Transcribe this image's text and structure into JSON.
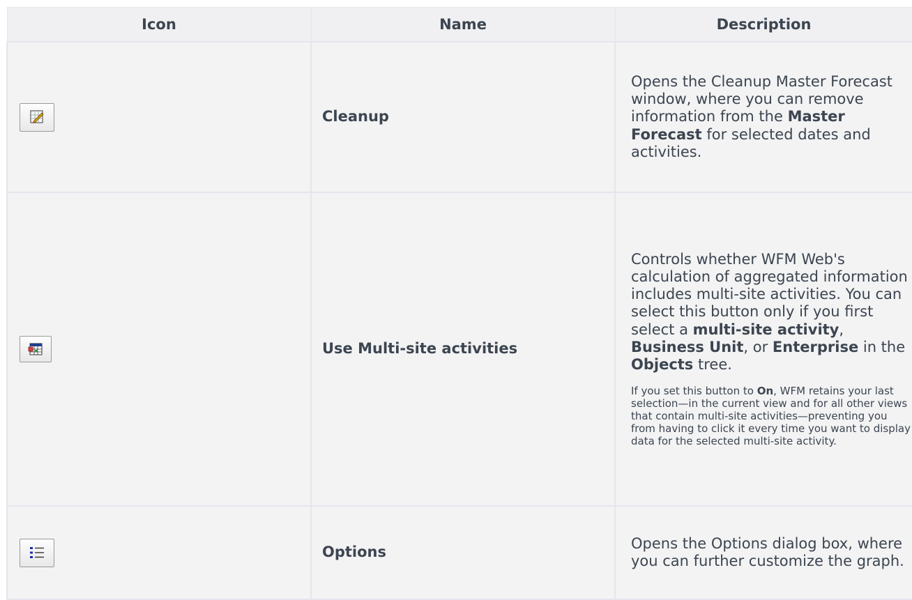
{
  "table": {
    "headers": {
      "icon": "Icon",
      "name": "Name",
      "description": "Description"
    },
    "rows": [
      {
        "icon": "cleanup-icon",
        "name": "Cleanup",
        "desc": {
          "t1": "Opens the Cleanup Master Forecast window, where you can remove information from the ",
          "b1": "Master Forecast",
          "t2": " for selected dates and activities."
        }
      },
      {
        "icon": "multi-site-activities-icon",
        "name": "Use Multi-site activities",
        "desc": {
          "t1": "Controls whether WFM Web's calculation of aggregated information includes multi-site activities. You can select this button only if you first select a ",
          "b1": "multi-site activity",
          "t2": ", ",
          "b2": "Business Unit",
          "t3": ", or ",
          "b3": "Enterprise",
          "t4": " in the ",
          "b4": "Objects",
          "t5": " tree."
        },
        "note": {
          "t1": "If you set this button to ",
          "b1": "On",
          "t2": ",  WFM retains your last selection—in the current view and for all other views that contain multi-site activities—preventing you from having to click it every time you want to display data for the selected multi-site activity."
        }
      },
      {
        "icon": "options-list-icon",
        "name": "Options",
        "desc": {
          "t1": "Opens the Options dialog box, where you can further customize the graph."
        }
      }
    ]
  }
}
